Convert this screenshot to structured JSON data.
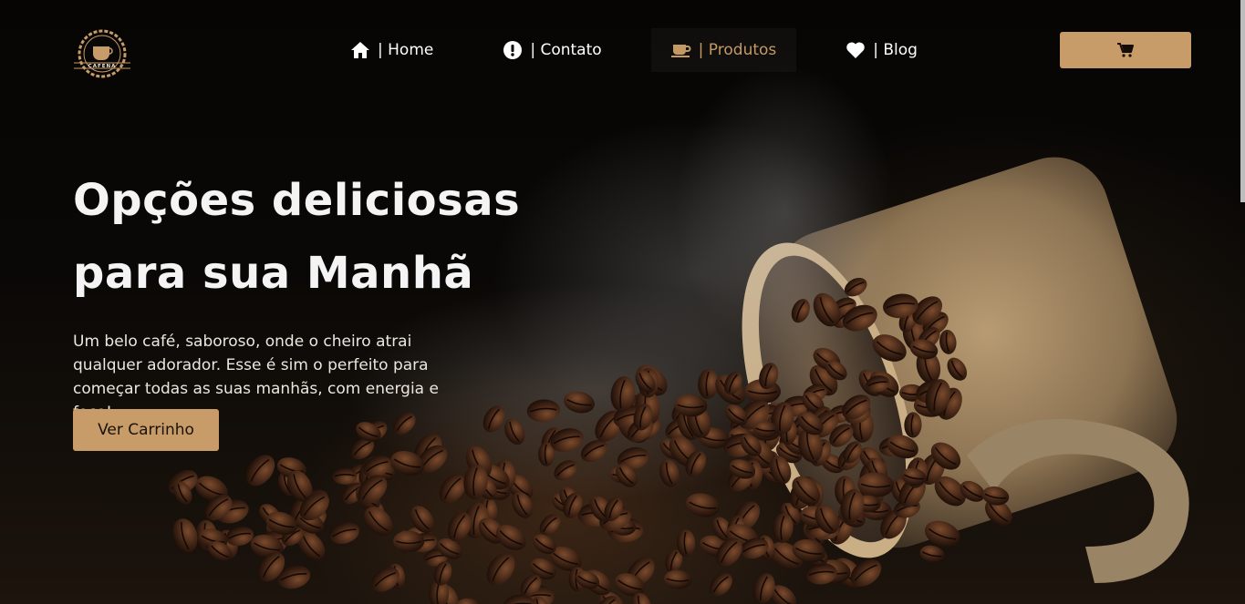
{
  "brand": {
    "logo_text": "CAFENA"
  },
  "nav": {
    "items": [
      {
        "label": "| Home",
        "icon": "home-icon"
      },
      {
        "label": "| Contato",
        "icon": "exclamation-circle-icon"
      },
      {
        "label": "| Produtos",
        "icon": "coffee-cup-icon",
        "active": true
      },
      {
        "label": "| Blog",
        "icon": "heart-icon"
      }
    ]
  },
  "cart": {
    "icon": "cart-icon"
  },
  "hero": {
    "title_line1": "Opções deliciosas",
    "title_line2": "para sua Manhã",
    "description": "Um belo café, saboroso, onde o cheiro atrai qualquer adorador. Esse é sim o perfeito para começar todas as suas manhãs, com energia e foco!",
    "cta_label": "Ver Carrinho"
  },
  "colors": {
    "accent": "#c79c68",
    "active_nav": "#c39a64",
    "background": "#050403"
  }
}
